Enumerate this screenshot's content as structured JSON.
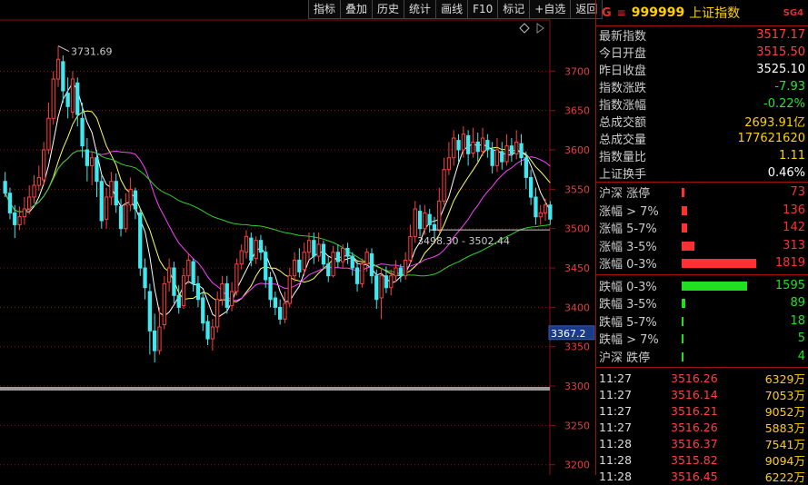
{
  "toolbar": {
    "buttons": [
      "指标",
      "叠加",
      "历史",
      "统计",
      "画线",
      "F10",
      "标记",
      "+自选",
      "返回"
    ]
  },
  "header": {
    "market_mark": "G",
    "menu_mark": "≡",
    "code": "999999",
    "name": "上证指数",
    "badge": "SG4"
  },
  "stats": [
    {
      "label": "最新指数",
      "value": "3517.17",
      "color": "#ff4040"
    },
    {
      "label": "今日开盘",
      "value": "3515.50",
      "color": "#ff4040"
    },
    {
      "label": "昨日收盘",
      "value": "3525.10",
      "color": "#ffffff"
    },
    {
      "label": "指数涨跌",
      "value": "-7.93",
      "color": "#30e030"
    },
    {
      "label": "指数涨幅",
      "value": "-0.22%",
      "color": "#30e030"
    },
    {
      "label": "总成交额",
      "value": "2693.91亿",
      "color": "#ffd000"
    },
    {
      "label": "总成交量",
      "value": "177621620",
      "color": "#ffd000"
    },
    {
      "label": "指数量比",
      "value": "1.11",
      "color": "#ffd000"
    },
    {
      "label": "上证换手",
      "value": "0.46%",
      "color": "#ffffff"
    }
  ],
  "breadth_up": [
    {
      "label": "沪深 涨停",
      "value": "73",
      "bar": 0.04
    },
    {
      "label": "涨幅 > 7%",
      "value": "136",
      "bar": 0.075
    },
    {
      "label": "涨幅 5-7%",
      "value": "142",
      "bar": 0.078
    },
    {
      "label": "涨幅 3-5%",
      "value": "313",
      "bar": 0.172
    },
    {
      "label": "涨幅 0-3%",
      "value": "1819",
      "bar": 1.0
    }
  ],
  "breadth_down": [
    {
      "label": "跌幅 0-3%",
      "value": "1595",
      "bar": 0.877
    },
    {
      "label": "跌幅 3-5%",
      "value": "89",
      "bar": 0.049
    },
    {
      "label": "跌幅 5-7%",
      "value": "18",
      "bar": 0.012
    },
    {
      "label": "跌幅 > 7%",
      "value": "5",
      "bar": 0.006
    },
    {
      "label": "沪深 跌停",
      "value": "4",
      "bar": 0.005
    }
  ],
  "ticks": [
    {
      "time": "11:27",
      "price": "3516.26",
      "volume": "6329万"
    },
    {
      "time": "11:27",
      "price": "3516.14",
      "volume": "7053万"
    },
    {
      "time": "11:27",
      "price": "3516.21",
      "volume": "9052万"
    },
    {
      "time": "11:27",
      "price": "3516.26",
      "volume": "5883万"
    },
    {
      "time": "11:28",
      "price": "3516.37",
      "volume": "7541万"
    },
    {
      "time": "11:28",
      "price": "3515.82",
      "volume": "9094万"
    },
    {
      "time": "11:28",
      "price": "3516.45",
      "volume": "6222万"
    }
  ],
  "colors": {
    "up": "#ff4040",
    "down": "#40e8f0",
    "ma5": "#ffffff",
    "ma10": "#ffff60",
    "ma20": "#ff40ff",
    "ma60": "#30d030",
    "grid": "#8a1010"
  },
  "chart_data": {
    "type": "candlestick",
    "y_ticks": [
      3700,
      3650,
      3600,
      3550,
      3500,
      3450,
      3400,
      3350,
      3300,
      3250,
      3200
    ],
    "ylim": [
      3187,
      3765
    ],
    "high_annotation": "3731.69",
    "range_annotation": "3498.30 - 3502.44",
    "current_marker": "3367.2",
    "reference_level": 3498.3,
    "candles": [
      [
        3560,
        3545,
        3572,
        3540
      ],
      [
        3545,
        3520,
        3552,
        3512
      ],
      [
        3520,
        3505,
        3530,
        3488
      ],
      [
        3505,
        3515,
        3528,
        3498
      ],
      [
        3515,
        3525,
        3540,
        3505
      ],
      [
        3525,
        3540,
        3555,
        3518
      ],
      [
        3540,
        3555,
        3568,
        3532
      ],
      [
        3555,
        3565,
        3580,
        3548
      ],
      [
        3562,
        3600,
        3610,
        3555
      ],
      [
        3600,
        3640,
        3660,
        3595
      ],
      [
        3640,
        3690,
        3700,
        3632
      ],
      [
        3690,
        3715,
        3732,
        3680
      ],
      [
        3712,
        3675,
        3720,
        3660
      ],
      [
        3672,
        3655,
        3692,
        3640
      ],
      [
        3648,
        3690,
        3700,
        3640
      ],
      [
        3685,
        3645,
        3692,
        3630
      ],
      [
        3640,
        3605,
        3660,
        3590
      ],
      [
        3600,
        3580,
        3615,
        3560
      ],
      [
        3580,
        3590,
        3598,
        3555
      ],
      [
        3590,
        3560,
        3600,
        3540
      ],
      [
        3560,
        3510,
        3568,
        3500
      ],
      [
        3512,
        3540,
        3552,
        3500
      ],
      [
        3540,
        3560,
        3572,
        3530
      ],
      [
        3560,
        3530,
        3570,
        3520
      ],
      [
        3528,
        3500,
        3538,
        3490
      ],
      [
        3500,
        3530,
        3545,
        3495
      ],
      [
        3530,
        3550,
        3565,
        3522
      ],
      [
        3548,
        3525,
        3552,
        3512
      ],
      [
        3520,
        3450,
        3526,
        3440
      ],
      [
        3450,
        3425,
        3462,
        3410
      ],
      [
        3420,
        3370,
        3430,
        3340
      ],
      [
        3370,
        3345,
        3392,
        3330
      ],
      [
        3345,
        3375,
        3400,
        3340
      ],
      [
        3378,
        3430,
        3440,
        3372
      ],
      [
        3432,
        3450,
        3462,
        3420
      ],
      [
        3450,
        3415,
        3458,
        3405
      ],
      [
        3415,
        3400,
        3428,
        3392
      ],
      [
        3402,
        3440,
        3450,
        3398
      ],
      [
        3440,
        3460,
        3468,
        3430
      ],
      [
        3458,
        3430,
        3462,
        3420
      ],
      [
        3430,
        3410,
        3440,
        3400
      ],
      [
        3412,
        3380,
        3420,
        3370
      ],
      [
        3382,
        3360,
        3390,
        3352
      ],
      [
        3360,
        3375,
        3385,
        3345
      ],
      [
        3375,
        3410,
        3420,
        3368
      ],
      [
        3410,
        3430,
        3440,
        3402
      ],
      [
        3430,
        3400,
        3440,
        3392
      ],
      [
        3402,
        3420,
        3432,
        3395
      ],
      [
        3420,
        3455,
        3462,
        3415
      ],
      [
        3455,
        3472,
        3480,
        3448
      ],
      [
        3470,
        3490,
        3498,
        3462
      ],
      [
        3488,
        3460,
        3495,
        3452
      ],
      [
        3462,
        3485,
        3490,
        3455
      ],
      [
        3485,
        3470,
        3492,
        3460
      ],
      [
        3470,
        3435,
        3478,
        3425
      ],
      [
        3438,
        3410,
        3445,
        3400
      ],
      [
        3412,
        3400,
        3420,
        3390
      ],
      [
        3400,
        3385,
        3410,
        3378
      ],
      [
        3385,
        3405,
        3420,
        3380
      ],
      [
        3405,
        3440,
        3450,
        3400
      ],
      [
        3440,
        3460,
        3470,
        3432
      ],
      [
        3460,
        3445,
        3475,
        3438
      ],
      [
        3448,
        3470,
        3482,
        3440
      ],
      [
        3470,
        3485,
        3495,
        3460
      ],
      [
        3485,
        3465,
        3495,
        3455
      ],
      [
        3465,
        3480,
        3495,
        3458
      ],
      [
        3480,
        3455,
        3485,
        3448
      ],
      [
        3455,
        3440,
        3465,
        3432
      ],
      [
        3440,
        3470,
        3478,
        3438
      ],
      [
        3470,
        3458,
        3480,
        3450
      ],
      [
        3458,
        3475,
        3480,
        3450
      ],
      [
        3475,
        3465,
        3482,
        3455
      ],
      [
        3465,
        3450,
        3470,
        3440
      ],
      [
        3450,
        3430,
        3460,
        3420
      ],
      [
        3430,
        3455,
        3462,
        3425
      ],
      [
        3455,
        3470,
        3475,
        3445
      ],
      [
        3468,
        3440,
        3475,
        3430
      ],
      [
        3440,
        3410,
        3448,
        3398
      ],
      [
        3412,
        3440,
        3450,
        3385
      ],
      [
        3440,
        3425,
        3452,
        3418
      ],
      [
        3425,
        3440,
        3448,
        3415
      ],
      [
        3440,
        3450,
        3460,
        3432
      ],
      [
        3450,
        3440,
        3455,
        3432
      ],
      [
        3440,
        3460,
        3470,
        3435
      ],
      [
        3460,
        3490,
        3505,
        3455
      ],
      [
        3490,
        3525,
        3535,
        3482
      ],
      [
        3522,
        3500,
        3530,
        3490
      ],
      [
        3500,
        3520,
        3530,
        3492
      ],
      [
        3518,
        3505,
        3525,
        3495
      ],
      [
        3505,
        3498,
        3515,
        3485
      ],
      [
        3498,
        3535,
        3552,
        3495
      ],
      [
        3535,
        3575,
        3590,
        3530
      ],
      [
        3575,
        3590,
        3610,
        3568
      ],
      [
        3590,
        3615,
        3625,
        3580
      ],
      [
        3612,
        3600,
        3620,
        3585
      ],
      [
        3600,
        3620,
        3630,
        3590
      ],
      [
        3618,
        3595,
        3625,
        3580
      ],
      [
        3596,
        3610,
        3628,
        3590
      ],
      [
        3610,
        3598,
        3622,
        3585
      ],
      [
        3598,
        3615,
        3628,
        3592
      ],
      [
        3612,
        3600,
        3620,
        3590
      ],
      [
        3600,
        3580,
        3610,
        3570
      ],
      [
        3580,
        3600,
        3615,
        3572
      ],
      [
        3598,
        3585,
        3610,
        3575
      ],
      [
        3585,
        3605,
        3620,
        3580
      ],
      [
        3605,
        3595,
        3615,
        3585
      ],
      [
        3595,
        3610,
        3625,
        3588
      ],
      [
        3608,
        3590,
        3620,
        3580
      ],
      [
        3590,
        3565,
        3598,
        3550
      ],
      [
        3565,
        3540,
        3575,
        3530
      ],
      [
        3540,
        3515,
        3552,
        3505
      ],
      [
        3515,
        3520,
        3530,
        3505
      ],
      [
        3520,
        3530,
        3538,
        3510
      ],
      [
        3530,
        3512,
        3535,
        3505
      ]
    ],
    "ma_periods": [
      5,
      10,
      20,
      60
    ]
  }
}
